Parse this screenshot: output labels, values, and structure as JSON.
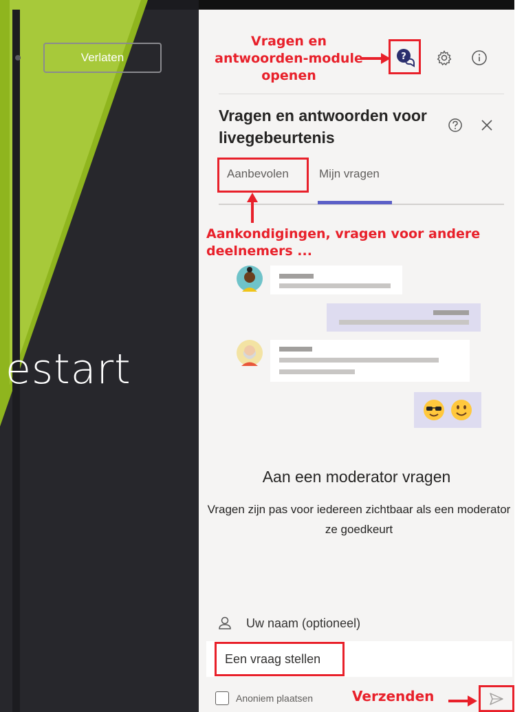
{
  "stage": {
    "leave_label": "Verlaten",
    "stage_text": "estart"
  },
  "panel": {
    "title": "Vragen en antwoorden voor livegebeurtenis",
    "tabs": [
      {
        "label": "Aanbevolen",
        "selected": false
      },
      {
        "label": "Mijn vragen",
        "selected": true
      }
    ],
    "ask_title": "Aan een moderator vragen",
    "ask_description": "Vragen zijn pas voor iedereen zichtbaar als een moderator ze goedkeurt",
    "name_placeholder": "Uw naam (optioneel)",
    "question_placeholder": "Een vraag stellen",
    "anonymous_label": "Anoniem plaatsen"
  },
  "annotations": {
    "open_module": "Vragen en antwoorden-module openen",
    "recommended": "Aankondigingen, vragen voor andere deelnemers ...",
    "send": "Verzenden"
  },
  "icons": {
    "qa": "qa-chat-icon",
    "settings": "gear-icon",
    "info": "info-icon",
    "help": "help-icon",
    "close": "close-icon",
    "person": "person-icon",
    "send": "send-icon"
  },
  "colors": {
    "annotation_red": "#e8202a",
    "accent": "#5b5fc7",
    "stage_bg": "#27272c",
    "wedge_green": "#8fb51e"
  }
}
